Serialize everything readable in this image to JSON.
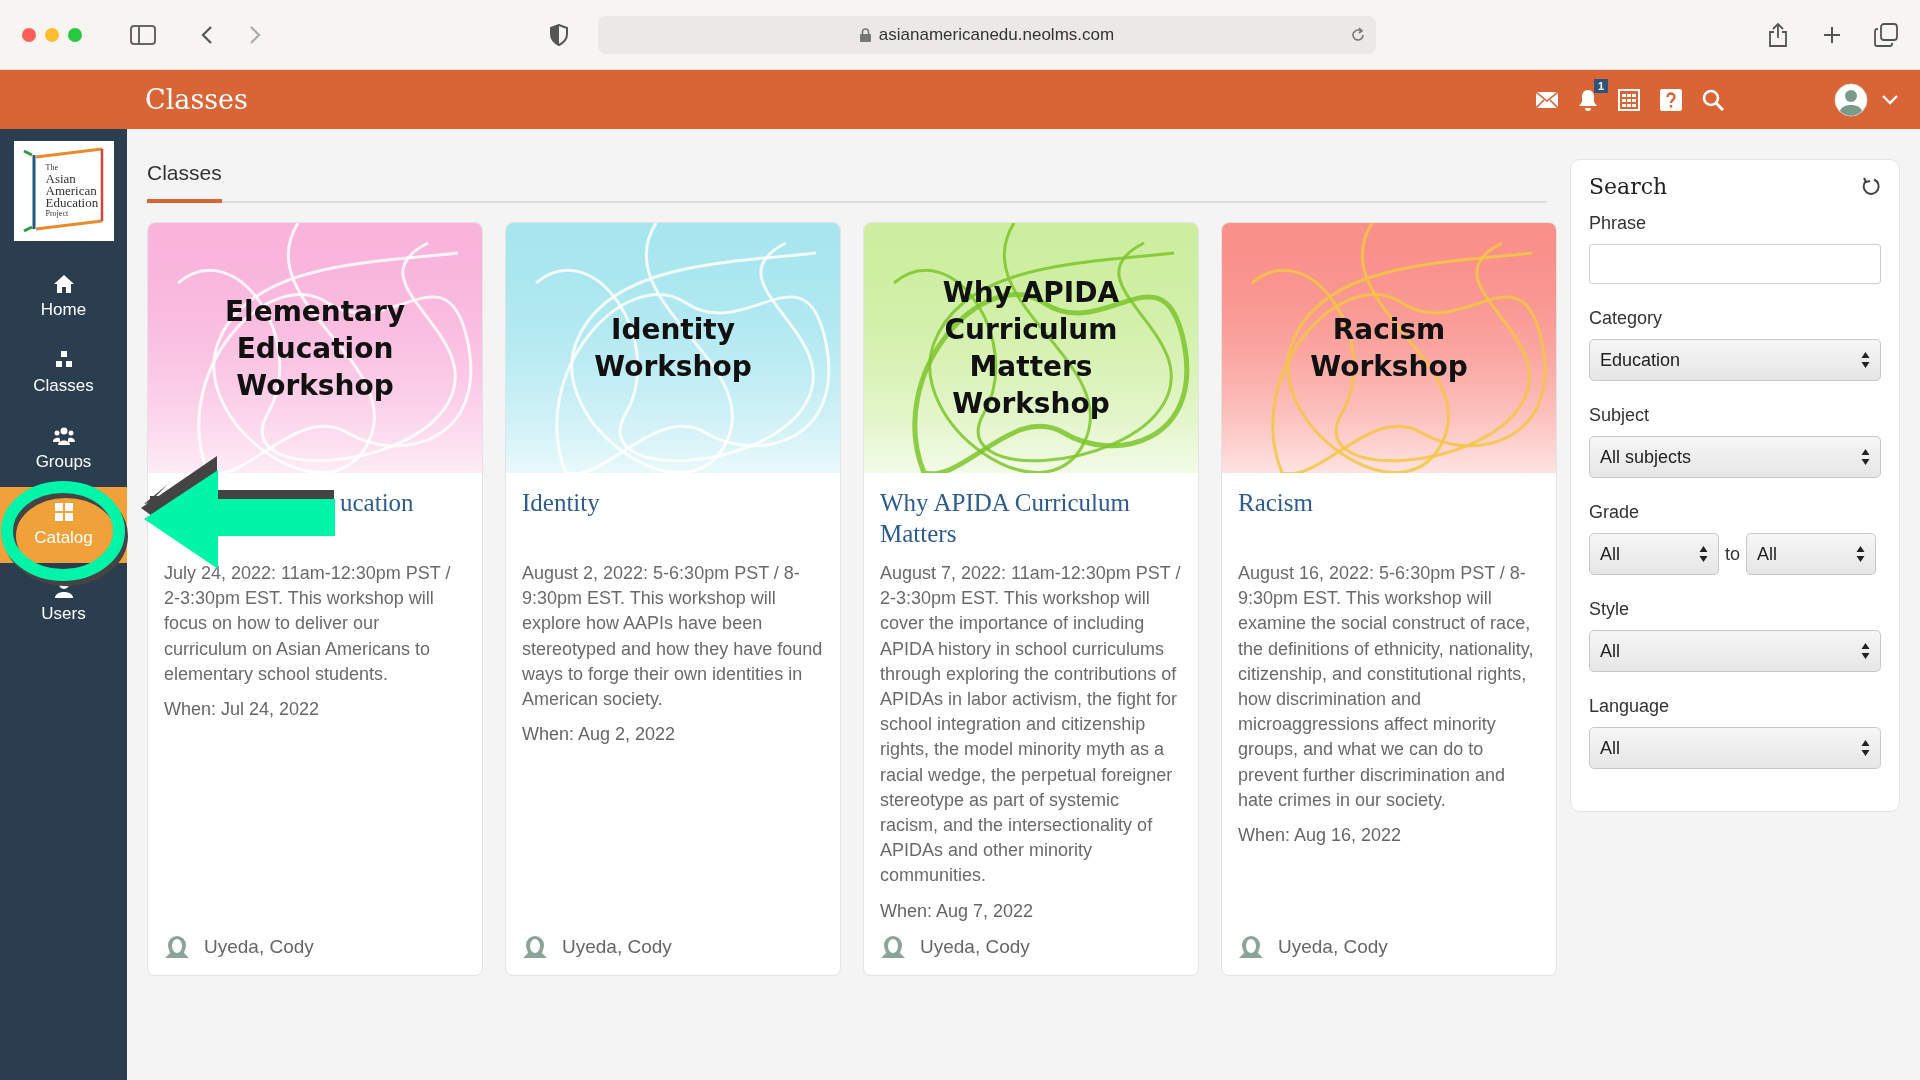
{
  "browser": {
    "url": "asianamericanedu.neolms.com"
  },
  "header": {
    "title": "Classes",
    "notification_count": "1"
  },
  "logo": {
    "lines": [
      "The",
      "Asian",
      "American",
      "Education",
      "Project"
    ]
  },
  "sidebar": {
    "items": [
      {
        "label": "Home",
        "kind": "home",
        "selected": false
      },
      {
        "label": "Classes",
        "kind": "classes",
        "selected": false
      },
      {
        "label": "Groups",
        "kind": "groups",
        "selected": false
      },
      {
        "label": "Catalog",
        "kind": "catalog",
        "selected": true
      },
      {
        "label": "Users",
        "kind": "users",
        "selected": false
      }
    ]
  },
  "tabs": [
    {
      "label": "Classes",
      "selected": true
    }
  ],
  "classes": [
    {
      "banner": "Elementary Education Workshop",
      "color": "#f9b4dc",
      "title": "ucation",
      "covered": true,
      "description": "July 24, 2022: 11am-12:30pm PST / 2-3:30pm EST. This workshop will focus on how to deliver our curriculum on Asian Americans to elementary school students.",
      "when": "When: Jul 24, 2022",
      "teacher": "Uyeda, Cody"
    },
    {
      "banner": "Identity Workshop",
      "color": "#a8e6ef",
      "title": "Identity",
      "covered": false,
      "description": "August 2, 2022: 5-6:30pm PST / 8-9:30pm EST. This workshop will explore how AAPIs have been stereotyped and how they have found ways to forge their own identities in American society.",
      "when": "When: Aug 2, 2022",
      "teacher": "Uyeda, Cody"
    },
    {
      "banner": "Why APIDA Curriculum Matters Workshop",
      "color": "#cdeea0",
      "title": "Why APIDA Curriculum Matters",
      "covered": false,
      "description": "August 7, 2022: 11am-12:30pm PST / 2-3:30pm EST. This workshop will cover the importance of including APIDA history in school curriculums through exploring the contributions of APIDAs in labor activism, the fight for school integration and citizenship rights, the model minority myth as a racial wedge, the perpetual foreigner stereotype as part of systemic racism, and the intersectionality of APIDAs and other minority communities.",
      "when": "When: Aug 7, 2022",
      "teacher": "Uyeda, Cody"
    },
    {
      "banner": "Racism Workshop",
      "color": "#f9908a",
      "title": "Racism",
      "covered": false,
      "description": "August 16, 2022: 5-6:30pm PST / 8-9:30pm EST. This workshop will examine the social construct of race, the definitions of ethnicity, nationality, citizenship, and constitutional rights, how discrimination and microaggressions affect minority groups, and what we can do to prevent further discrimination and hate crimes in our society.",
      "when": "When: Aug 16, 2022",
      "teacher": "Uyeda, Cody"
    }
  ],
  "search": {
    "title": "Search",
    "fields": [
      {
        "kind": "text",
        "label": "Phrase"
      },
      {
        "kind": "select",
        "label": "Category",
        "value": "Education"
      },
      {
        "kind": "select",
        "label": "Subject",
        "value": "All subjects"
      },
      {
        "kind": "range",
        "label": "Grade",
        "value": "All",
        "joiner": "to",
        "value_to": "All"
      },
      {
        "kind": "select",
        "label": "Style",
        "value": "All"
      },
      {
        "kind": "select",
        "label": "Language",
        "value": "All"
      }
    ]
  }
}
